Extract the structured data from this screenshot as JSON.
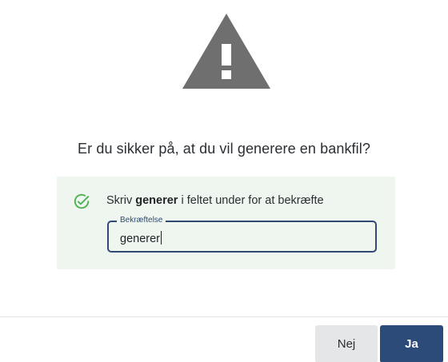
{
  "dialog": {
    "icon": "warning-triangle-icon",
    "question": "Er du sikker på, at du vil generere en bankfil?",
    "confirm": {
      "icon": "check-circle-icon",
      "instruction_prefix": "Skriv ",
      "instruction_keyword": "generer",
      "instruction_suffix": " i feltet under for at bekræfte",
      "field_label": "Bekræftelse",
      "field_value": "generer"
    },
    "buttons": {
      "no_label": "Nej",
      "yes_label": "Ja"
    }
  },
  "colors": {
    "warning_icon": "#6f6f6f",
    "success_bg": "#eef6ef",
    "success_icon": "#4caf50",
    "primary": "#2d4b78",
    "secondary_button": "#e5e6e8"
  }
}
